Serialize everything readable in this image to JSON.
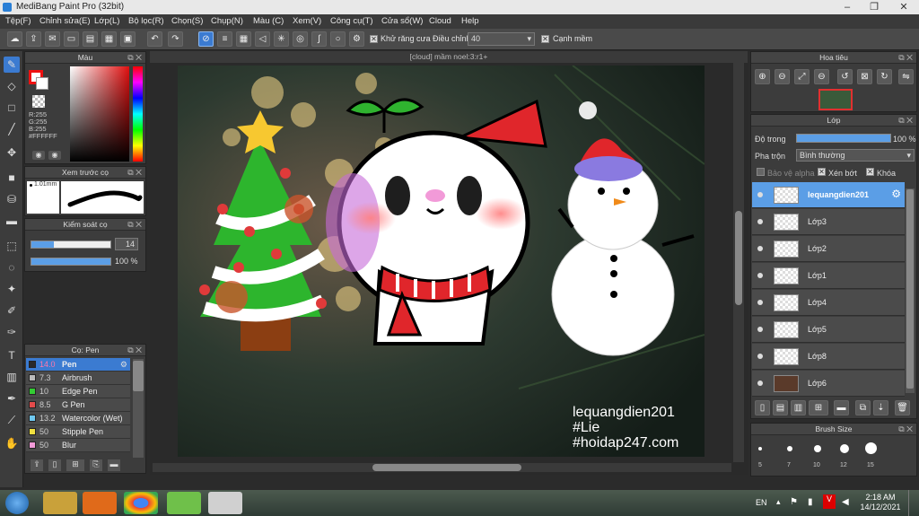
{
  "window": {
    "title": "MediBang Paint Pro (32bit)"
  },
  "menu": [
    "Tệp(F)",
    "Chỉnh sửa(E)",
    "Lớp(L)",
    "Bộ lọc(R)",
    "Chọn(S)",
    "Chụp(N)",
    "Màu (C)",
    "Xem(V)",
    "Công cụ(T)",
    "Cửa sổ(W)",
    "Cloud",
    "Help"
  ],
  "toolbar": {
    "antialias_label": "Khử răng cưa",
    "smoothing_label": "Điều chỉnh",
    "smoothing_value": "40",
    "canh_mem_label": "Cạnh mềm"
  },
  "color_panel": {
    "title": "Màu",
    "rgb": [
      "R:255",
      "G:255",
      "B:255"
    ],
    "hex": "#FFFFFF"
  },
  "preview_panel": {
    "title": "Xem trước cọ",
    "size": "1.01mm"
  },
  "brush_control": {
    "title": "Kiểm soát cọ",
    "size_value": "14",
    "opacity_value": "100 %"
  },
  "brush_panel": {
    "title": "Cọ: Pen",
    "items": [
      {
        "size": "14.0",
        "name": "Pen",
        "color": "#2a2a2a"
      },
      {
        "size": "7.3",
        "name": "Airbrush",
        "color": "#bbbbbb"
      },
      {
        "size": "10",
        "name": "Edge Pen",
        "color": "#33cc33"
      },
      {
        "size": "8.5",
        "name": "G Pen",
        "color": "#e34b4b"
      },
      {
        "size": "13.2",
        "name": "Watercolor (Wet)",
        "color": "#6fc8f0"
      },
      {
        "size": "50",
        "name": "Stipple Pen",
        "color": "#f0e040"
      },
      {
        "size": "50",
        "name": "Blur",
        "color": "#f29ad8"
      }
    ]
  },
  "canvas": {
    "tab_title": "[cloud] mầm noel:3:r1+",
    "watermark": [
      "lequangdien201",
      "#Lie",
      "#hoidap247.com"
    ]
  },
  "navigator": {
    "title": "Hoa tiêu"
  },
  "layers_panel": {
    "title": "Lớp",
    "opacity_label": "Độ trong",
    "opacity_value": "100 %",
    "blend_label": "Pha trộn",
    "blend_value": "Bình thường",
    "protect_alpha": "Bảo vệ alpha",
    "clipping": "Xén bớt",
    "lock": "Khóa",
    "layers": [
      "lequangdien201",
      "Lớp3",
      "Lớp2",
      "Lớp1",
      "Lớp4",
      "Lớp5",
      "Lớp8",
      "Lớp6"
    ]
  },
  "brush_size_panel": {
    "title": "Brush Size",
    "sizes": [
      "5",
      "7",
      "10",
      "12",
      "15"
    ]
  },
  "taskbar": {
    "lang": "EN",
    "time": "2:18 AM",
    "date": "14/12/2021"
  },
  "colors": {
    "accent": "#3b7bd1",
    "selected_layer": "#5b9ee6"
  }
}
